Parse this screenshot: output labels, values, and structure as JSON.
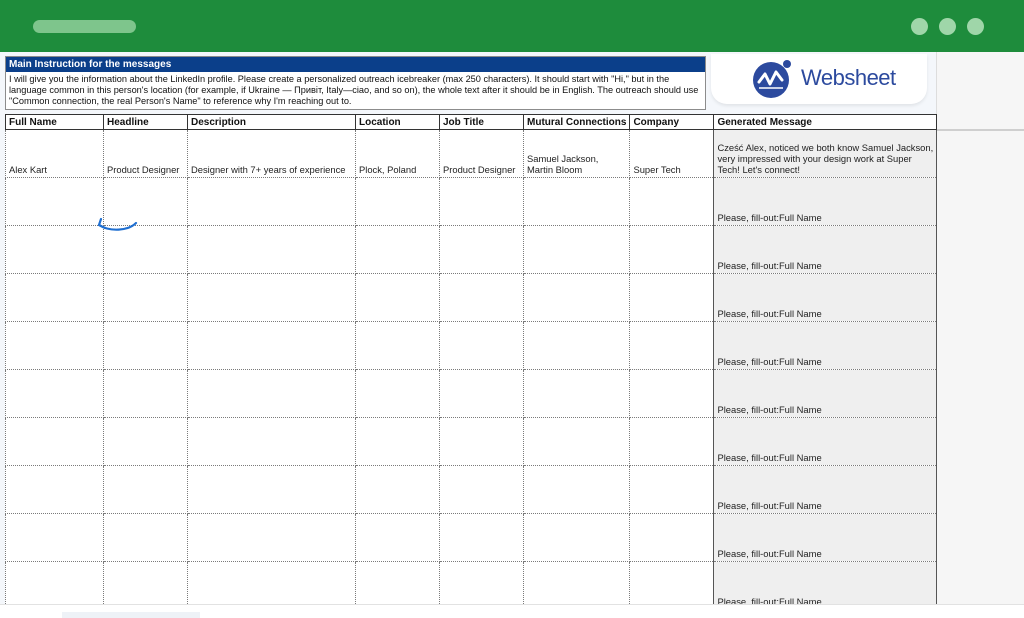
{
  "window": {
    "accent": "#1e8c3c",
    "controls": [
      "dot-1",
      "dot-2",
      "dot-3"
    ]
  },
  "instructions": {
    "title": "Main Instruction for the messages",
    "text": "I will give you the information about the LinkedIn profile. Please create a personalized outreach icebreaker (max 250 characters). It should start with \"Hi,\" but in the language common in this person's location (for example, if Ukraine — Привіт, Italy—ciao, and so on), the whole text after it should be in English. The outreach should use \"Common connection, the real Person's Name\" to reference why I'm reaching out to."
  },
  "logo": {
    "text": "Websheet",
    "color": "#2c4a9e"
  },
  "table": {
    "headers": [
      "Full Name",
      "Headline",
      "Description",
      "Location",
      "Job Title",
      "Mutural Connections",
      "Company",
      "Generated Message"
    ],
    "rows": [
      [
        "Alex Kart",
        "Product Designer",
        "Designer with 7+ years of experience",
        "Plock, Poland",
        "Product Designer",
        "Samuel Jackson, Martin Bloom",
        "Super Tech",
        "Cześć Alex, noticed we both know Samuel Jackson, very impressed with your design work at Super Tech! Let's connect!"
      ],
      [
        "",
        "",
        "",
        "",
        "",
        "",
        "",
        "Please, fill-out:Full Name"
      ],
      [
        "",
        "",
        "",
        "",
        "",
        "",
        "",
        "Please, fill-out:Full Name"
      ],
      [
        "",
        "",
        "",
        "",
        "",
        "",
        "",
        "Please, fill-out:Full Name"
      ],
      [
        "",
        "",
        "",
        "",
        "",
        "",
        "",
        "Please, fill-out:Full Name"
      ],
      [
        "",
        "",
        "",
        "",
        "",
        "",
        "",
        "Please, fill-out:Full Name"
      ],
      [
        "",
        "",
        "",
        "",
        "",
        "",
        "",
        "Please, fill-out:Full Name"
      ],
      [
        "",
        "",
        "",
        "",
        "",
        "",
        "",
        "Please, fill-out:Full Name"
      ],
      [
        "",
        "",
        "",
        "",
        "",
        "",
        "",
        "Please, fill-out:Full Name"
      ],
      [
        "",
        "",
        "",
        "",
        "",
        "",
        "",
        "Please, fill-out:Full Name"
      ]
    ]
  },
  "annotation": {
    "icon": "curved-arrow-left-icon",
    "color": "#1f6fd1"
  }
}
